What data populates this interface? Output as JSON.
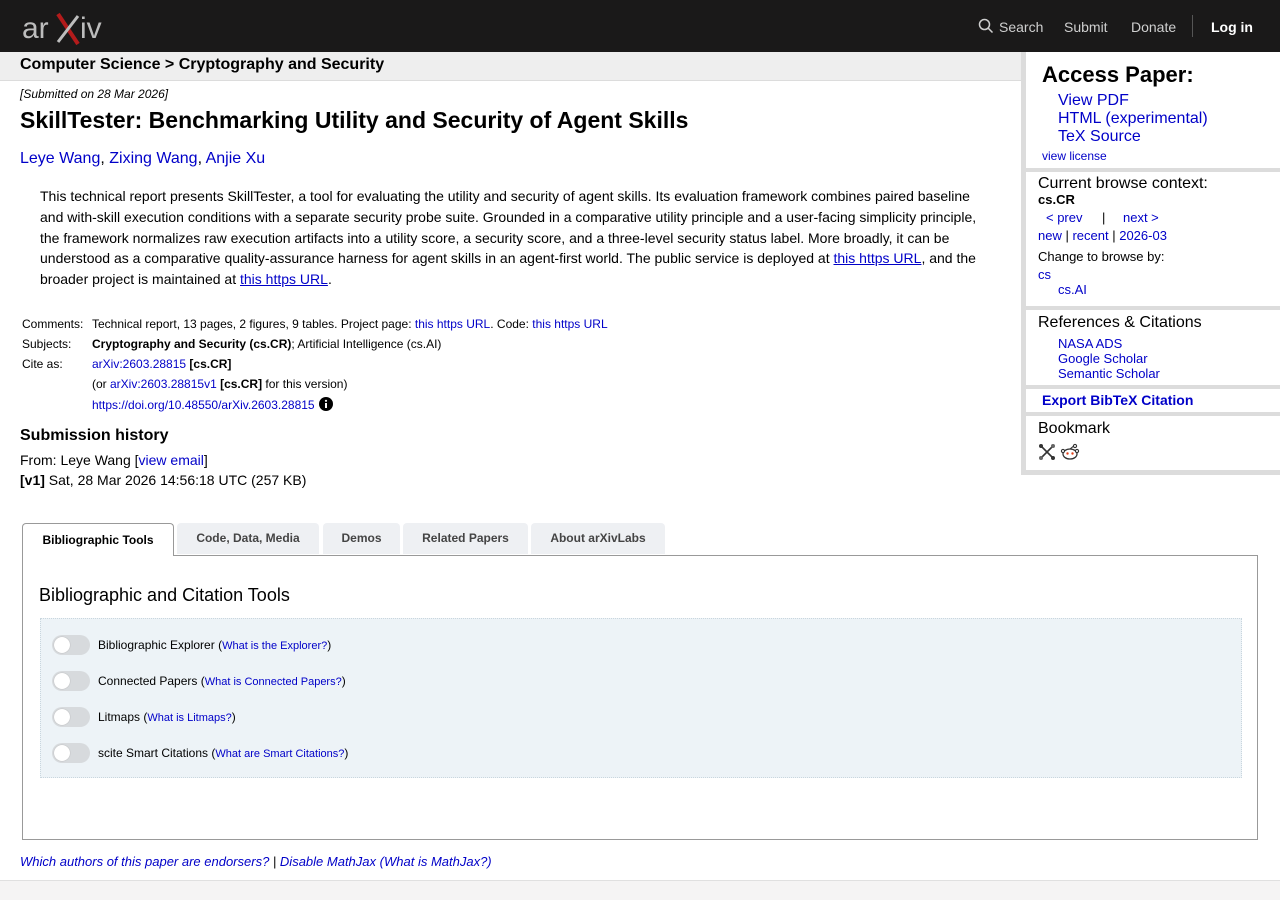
{
  "nav": {
    "logo_text": "arXiv",
    "search": "Search",
    "submit": "Submit",
    "donate": "Donate",
    "login": "Log in"
  },
  "breadcrumb": "Computer Science > Cryptography and Security",
  "submitted": "[Submitted on 28 Mar 2026]",
  "title": "SkillTester: Benchmarking Utility and Security of Agent Skills",
  "authors": [
    "Leye Wang",
    "Zixing Wang",
    "Anjie Xu"
  ],
  "abstract": {
    "text": "This technical report presents SkillTester, a tool for evaluating the utility and security of agent skills. Its evaluation framework combines paired baseline and with-skill execution conditions with a separate security probe suite. Grounded in a comparative utility principle and a user-facing simplicity principle, the framework normalizes raw execution artifacts into a utility score, a security score, and a three-level security status label. More broadly, it can be understood as a comparative quality-assurance harness for agent skills in an agent-first world. The public service is deployed at ",
    "link1": "this https URL",
    "mid": ", and the broader project is maintained at ",
    "link2": "this https URL",
    "end": "."
  },
  "meta": {
    "comments_label": "Comments:",
    "comments_text": "Technical report, 13 pages, 2 figures, 9 tables. Project page: ",
    "comments_link1": "this https URL",
    "comments_code": ". Code: ",
    "comments_link2": "this https URL",
    "subjects_label": "Subjects:",
    "subjects_primary": "Cryptography and Security (cs.CR)",
    "subjects_rest": "; Artificial Intelligence (cs.AI)",
    "cite_label": "Cite as:",
    "cite_id": "arXiv:2603.28815",
    "cite_cat": " [cs.CR]",
    "cite_or": "(or ",
    "cite_version": "arXiv:2603.28815v1",
    "cite_version_cat": " [cs.CR]",
    "cite_version_tail": " for this version)",
    "doi": "https://doi.org/10.48550/arXiv.2603.28815"
  },
  "history": {
    "title": "Submission history",
    "from": "From: Leye Wang [",
    "view_email": "view email",
    "from_end": "]",
    "v1_label": "[v1]",
    "v1_text": " Sat, 28 Mar 2026 14:56:18 UTC (257 KB)"
  },
  "tabs": [
    "Bibliographic Tools",
    "Code, Data, Media",
    "Demos",
    "Related Papers",
    "About arXivLabs"
  ],
  "panel_title": "Bibliographic and Citation Tools",
  "tools": [
    {
      "label": "Bibliographic Explorer",
      "help": "What is the Explorer?"
    },
    {
      "label": "Connected Papers",
      "help": "What is Connected Papers?"
    },
    {
      "label": "Litmaps",
      "help": "What is Litmaps?"
    },
    {
      "label": "scite Smart Citations",
      "help": "What are Smart Citations?"
    }
  ],
  "footer": {
    "endorsers": "Which authors of this paper are endorsers?",
    "sep": " | ",
    "disable_mathjax": "Disable MathJax",
    "what_mathjax": "(What is MathJax?)"
  },
  "sidebar": {
    "access_title": "Access Paper:",
    "view_pdf": "View PDF",
    "html": "HTML (experimental)",
    "tex": "TeX Source",
    "license": "view license",
    "context_title": "Current browse context:",
    "context_cat": "cs.CR",
    "prev": "< prev",
    "pipe": "|",
    "next": "next >",
    "new": "new",
    "recent": "recent",
    "month": "2026-03",
    "change_browse": "Change to browse by:",
    "browse_cs": "cs",
    "browse_csai": "cs.AI",
    "refs_title": "References & Citations",
    "nasa": "NASA ADS",
    "google": "Google Scholar",
    "semantic": "Semantic Scholar",
    "export": "Export BibTeX Citation",
    "bookmark": "Bookmark"
  },
  "colors": {
    "link": "#0000c8",
    "topbar": "#1a1919",
    "logo_x": "#b31b1b"
  }
}
